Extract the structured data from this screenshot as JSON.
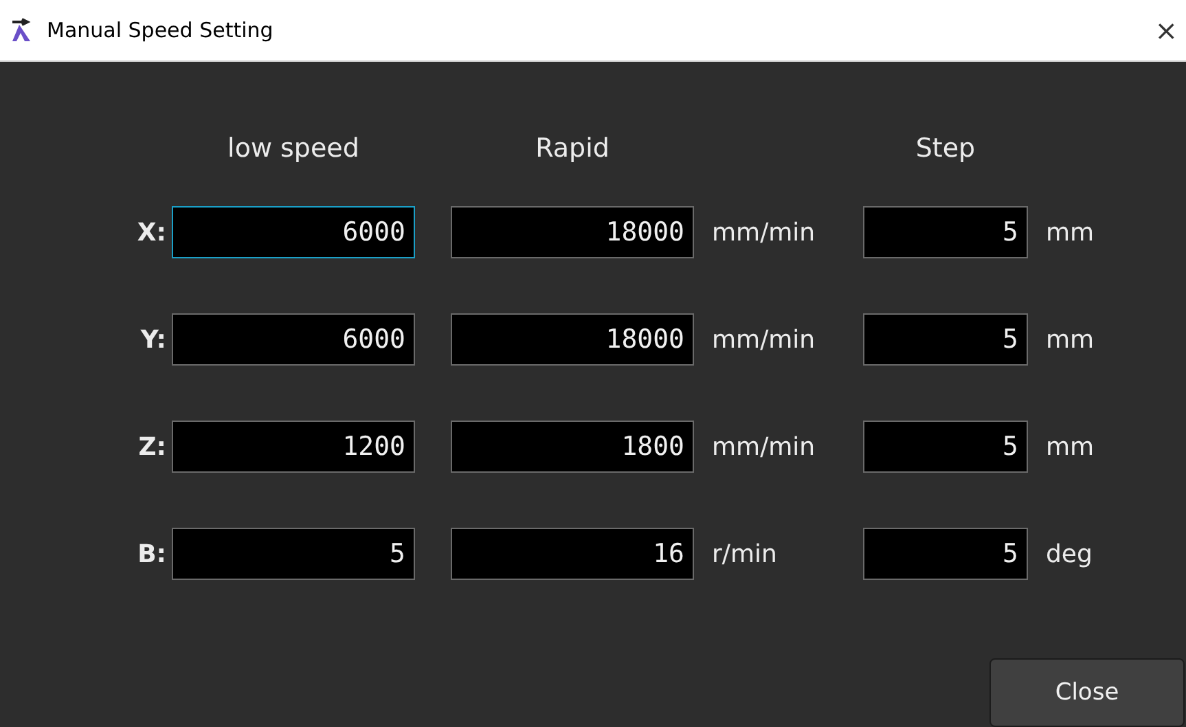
{
  "window": {
    "title": "Manual Speed Setting",
    "close_glyph": "×"
  },
  "headers": [
    "low speed",
    "Rapid",
    "Step"
  ],
  "rows": [
    {
      "axis": "X:",
      "low": {
        "value": "6000",
        "focused": true
      },
      "rapid": {
        "value": "18000",
        "focused": false
      },
      "rapid_unit": "mm/min",
      "step": {
        "value": "5",
        "focused": false
      },
      "step_unit": "mm"
    },
    {
      "axis": "Y:",
      "low": {
        "value": "6000",
        "focused": false
      },
      "rapid": {
        "value": "18000",
        "focused": false
      },
      "rapid_unit": "mm/min",
      "step": {
        "value": "5",
        "focused": false
      },
      "step_unit": "mm"
    },
    {
      "axis": "Z:",
      "low": {
        "value": "1200",
        "focused": false
      },
      "rapid": {
        "value": "1800",
        "focused": false
      },
      "rapid_unit": "mm/min",
      "step": {
        "value": "5",
        "focused": false
      },
      "step_unit": "mm"
    },
    {
      "axis": "B:",
      "low": {
        "value": "5",
        "focused": false
      },
      "rapid": {
        "value": "16",
        "focused": false
      },
      "rapid_unit": "r/min",
      "step": {
        "value": "5",
        "focused": false
      },
      "step_unit": "deg"
    }
  ],
  "buttons": [
    "Close"
  ]
}
